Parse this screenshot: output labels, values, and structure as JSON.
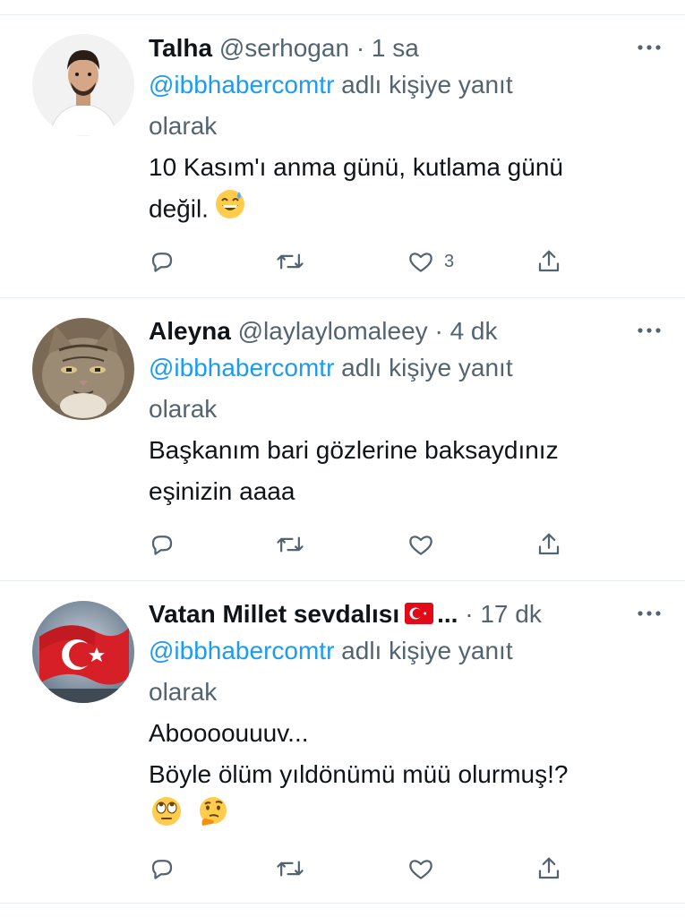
{
  "tweets": [
    {
      "name": "Talha",
      "handle": "@serhogan",
      "dot": "·",
      "time": "1 sa",
      "reply_mention": "@ibbhabercomtr",
      "reply_suffix": " adlı kişiye yanıt",
      "reply_line2": "olarak",
      "text_lines": [
        "10 Kasım'ı anma günü, kutlama günü",
        "değil."
      ],
      "emojis": [
        "grinning-sweat-emoji"
      ],
      "likes": "3"
    },
    {
      "name": "Aleyna",
      "handle": "@laylaylomaleey",
      "dot": "·",
      "time": "4 dk",
      "reply_mention": "@ibbhabercomtr",
      "reply_suffix": " adlı kişiye yanıt",
      "reply_line2": "olarak",
      "text_lines": [
        "Başkanım bari gözlerine baksaydınız",
        "eşinizin aaaa"
      ],
      "likes": ""
    },
    {
      "name": "Vatan Millet sevdalısı",
      "name_suffix": "...",
      "handle": "",
      "dot": "·",
      "time": "17 dk",
      "reply_mention": "@ibbhabercomtr",
      "reply_suffix": " adlı kişiye yanıt",
      "reply_line2": "olarak",
      "text_lines": [
        "Aboooouuuv...",
        "Böyle ölüm yıldönümü müü olurmuş!?"
      ],
      "emojis": [
        "eye-roll-emoji",
        "thinking-emoji"
      ],
      "likes": ""
    }
  ],
  "icons": {
    "reply": "reply-icon",
    "retweet": "retweet-icon",
    "like": "heart-icon",
    "share": "share-icon",
    "more": "more-icon"
  },
  "colors": {
    "mention": "#1d9bf0",
    "secondary": "#536471",
    "divider": "#e6ecf0"
  }
}
